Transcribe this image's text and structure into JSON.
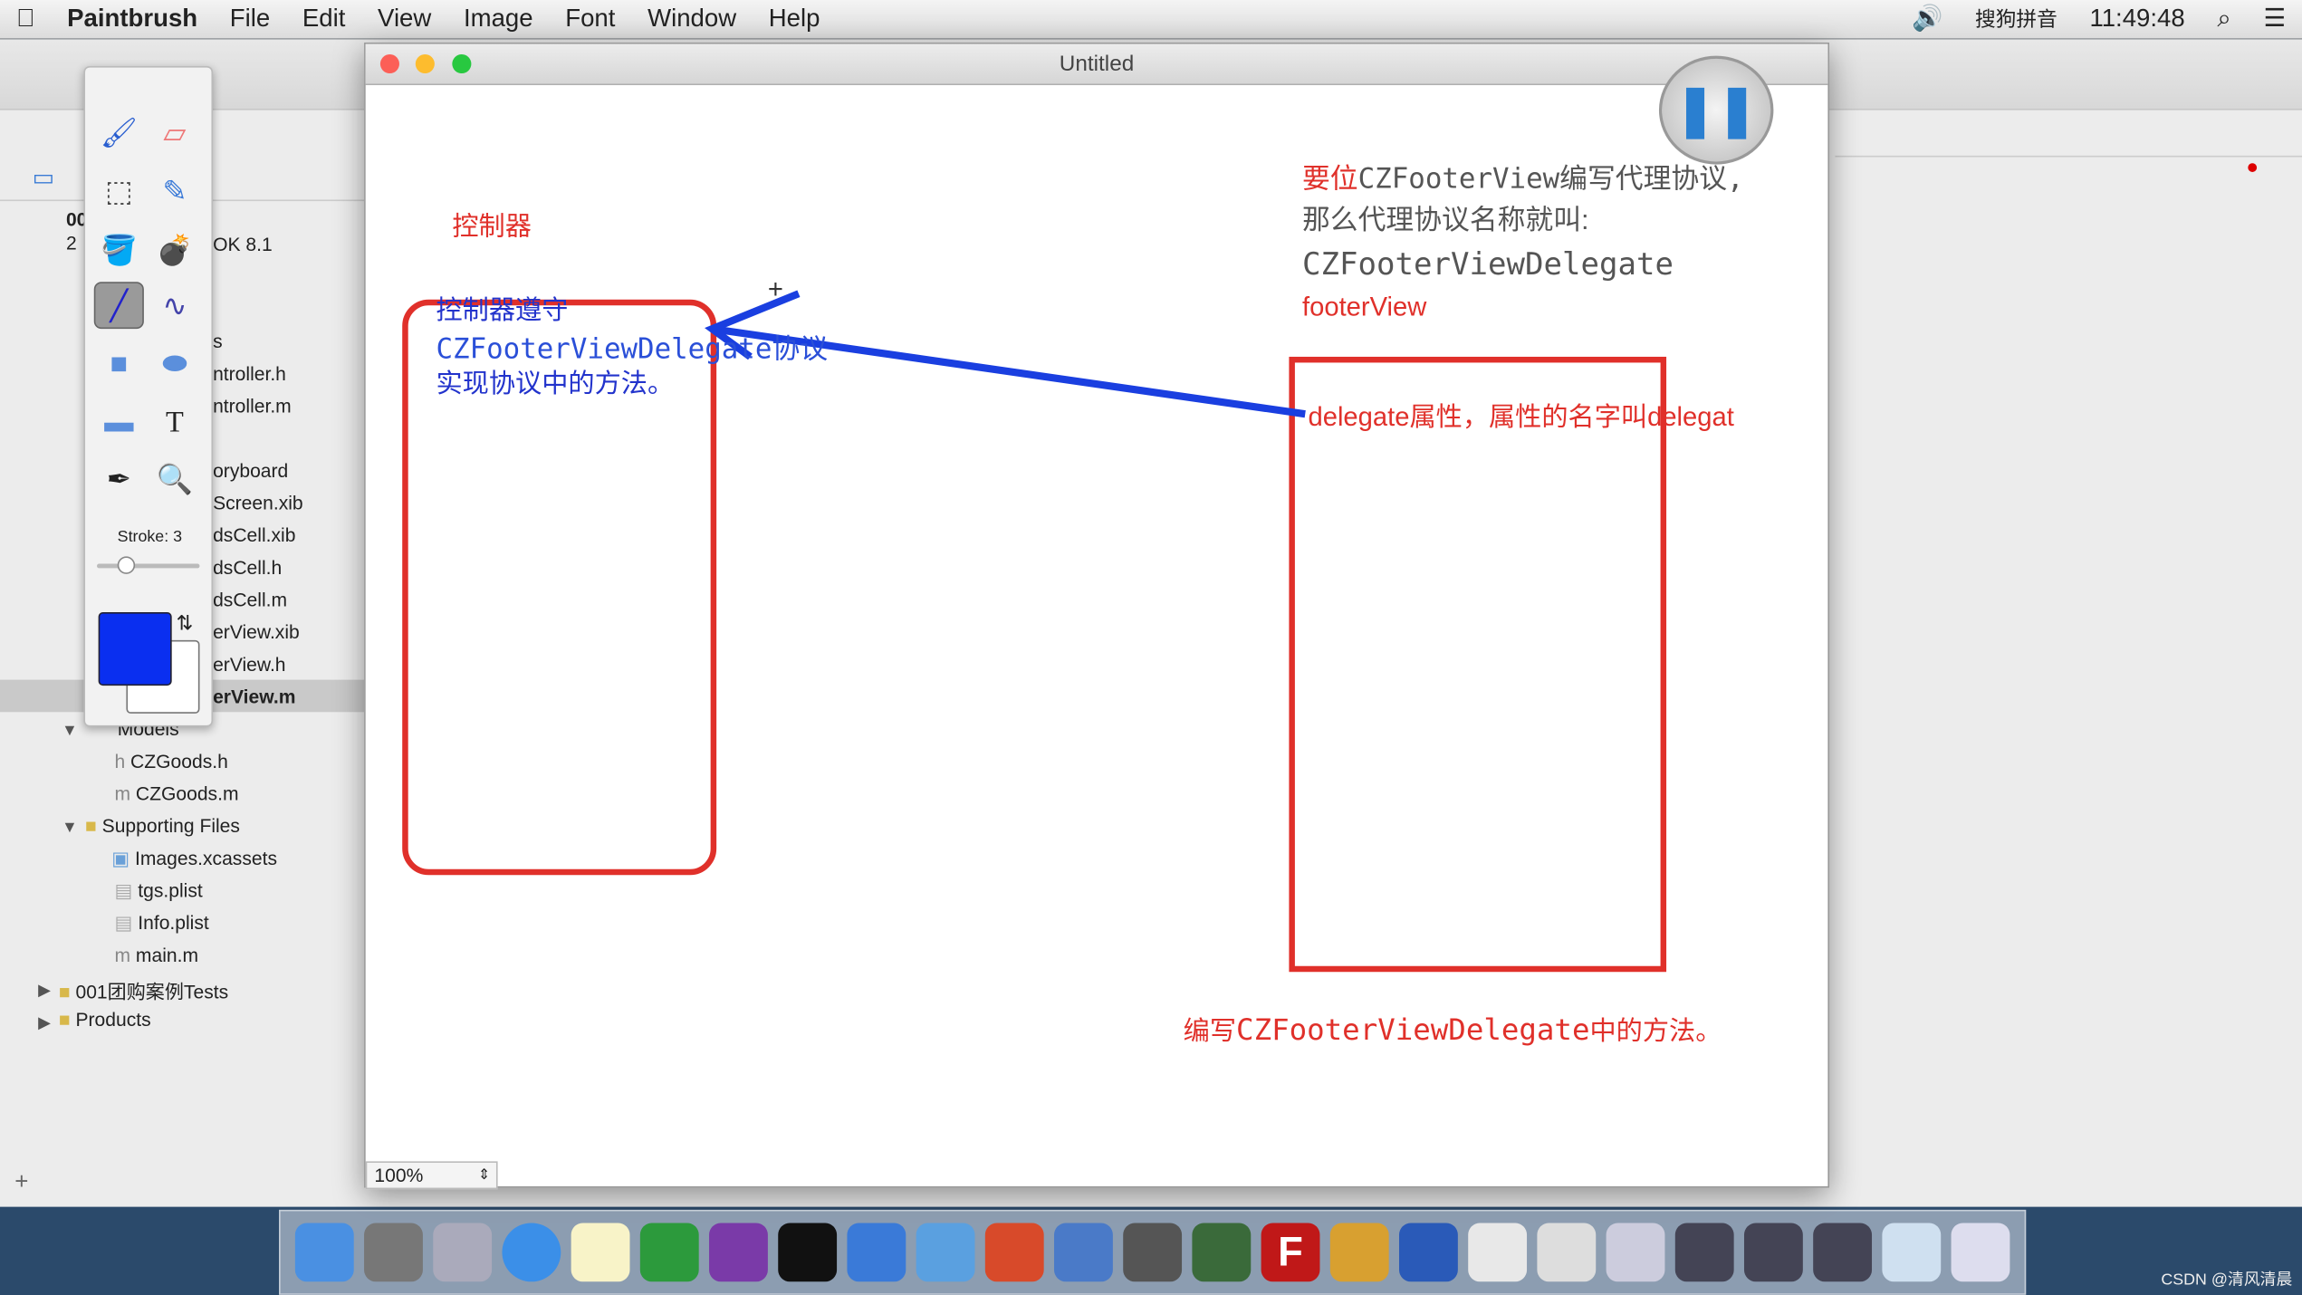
{
  "menubar": {
    "app": "Paintbrush",
    "items": [
      "File",
      "Edit",
      "View",
      "Image",
      "Font",
      "Window",
      "Help"
    ],
    "input_method": "搜狗拼音",
    "clock": "11:49:48"
  },
  "xcode": {
    "sdk": "OK 8.1",
    "project_partial": "00",
    "count_partial": "2",
    "files": [
      "s",
      "ntroller.h",
      "ntroller.m",
      "oryboard",
      "Screen.xib",
      "dsCell.xib",
      "dsCell.h",
      "dsCell.m",
      "erView.xib",
      "erView.h",
      "erView.m"
    ],
    "groups": [
      {
        "label": "Models",
        "type": "folder"
      },
      {
        "label": "CZGoods.h",
        "type": "h"
      },
      {
        "label": "CZGoods.m",
        "type": "m"
      },
      {
        "label": "Supporting Files",
        "type": "folder"
      },
      {
        "label": "Images.xcassets",
        "type": "assets"
      },
      {
        "label": "tgs.plist",
        "type": "plist"
      },
      {
        "label": "Info.plist",
        "type": "plist"
      },
      {
        "label": "main.m",
        "type": "m"
      },
      {
        "label": "001团购案例Tests",
        "type": "folder"
      },
      {
        "label": "Products",
        "type": "folder"
      }
    ]
  },
  "palette": {
    "stroke_label": "Stroke: 3",
    "stroke": 3,
    "foreground_color": "#0a2ff0",
    "background_color": "#ffffff",
    "selected_tool": "line"
  },
  "window": {
    "title": "Untitled",
    "zoom": "100%"
  },
  "canvas": {
    "label_controller": "控制器",
    "left_box": {
      "line1": "控制器遵守",
      "line2": "CZFooterViewDelegate协议",
      "line3": "实现协议中的方法。"
    },
    "note": {
      "prefix": "要位",
      "line1": "CZFooterView编写代理协议,",
      "line2": "那么代理协议名称就叫:",
      "line3": "CZFooterViewDelegate",
      "line4": "footerView"
    },
    "right_box_text": "delegate属性，属性的名字叫delegat",
    "bottom_text_prefix": "编写",
    "bottom_text_mono": "CZFooterViewDelegate",
    "bottom_text_suffix": "中的方法。",
    "colors": {
      "red": "#e0302a",
      "blue": "#1a3fe0"
    }
  },
  "dock": {
    "apps": [
      "finder",
      "system-preferences",
      "launchpad",
      "safari",
      "notes",
      "excel",
      "onenote",
      "terminal",
      "xcode",
      "preview",
      "powerpoint",
      "instruments",
      "photo-booth",
      "xhunt",
      "filezilla",
      "tools",
      "word",
      "textedit",
      "font-book",
      "screen",
      "display1",
      "display2",
      "display3",
      "folder",
      "trash"
    ]
  },
  "watermark": "CSDN @清风清晨"
}
